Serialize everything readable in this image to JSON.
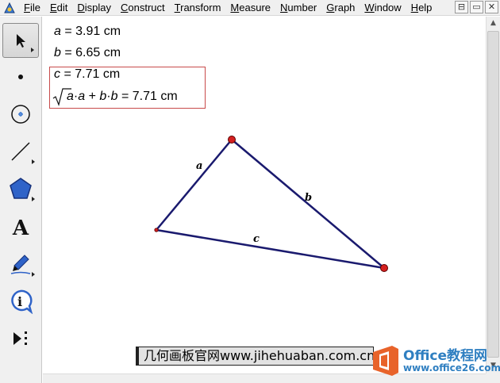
{
  "menubar": {
    "items": [
      {
        "label": "File"
      },
      {
        "label": "Edit"
      },
      {
        "label": "Display"
      },
      {
        "label": "Construct"
      },
      {
        "label": "Transform"
      },
      {
        "label": "Measure"
      },
      {
        "label": "Number"
      },
      {
        "label": "Graph"
      },
      {
        "label": "Window"
      },
      {
        "label": "Help"
      }
    ],
    "window_buttons": [
      "⊟",
      "▭",
      "✕"
    ]
  },
  "toolbox": {
    "tools": [
      {
        "name": "selection-arrow-tool",
        "active": true
      },
      {
        "name": "point-tool"
      },
      {
        "name": "compass-tool"
      },
      {
        "name": "straightedge-tool"
      },
      {
        "name": "polygon-tool"
      },
      {
        "name": "text-tool"
      },
      {
        "name": "marker-tool"
      },
      {
        "name": "information-tool"
      },
      {
        "name": "custom-tool"
      }
    ]
  },
  "measurements": {
    "a": {
      "var": "a",
      "text": " = 3.91 cm"
    },
    "b": {
      "var": "b",
      "text": " = 6.65 cm"
    },
    "c": {
      "var": "c",
      "text": " = 7.71 cm"
    },
    "calc": {
      "expr_a1": "a",
      "dot1": "·",
      "expr_a2": "a",
      "plus": " + ",
      "expr_b1": "b",
      "dot2": "·",
      "expr_b2": "b",
      "result": " = 7.71 cm"
    }
  },
  "triangle": {
    "label_a": "a",
    "label_b": "b",
    "label_c": "c",
    "line_color": "#1a1a6e",
    "point_color": "#d42020"
  },
  "watermark": {
    "banner_text": "几何画板官网www.jihehuaban.com.cn",
    "office_title": "Office教程网",
    "office_url": "www.office26.com"
  }
}
